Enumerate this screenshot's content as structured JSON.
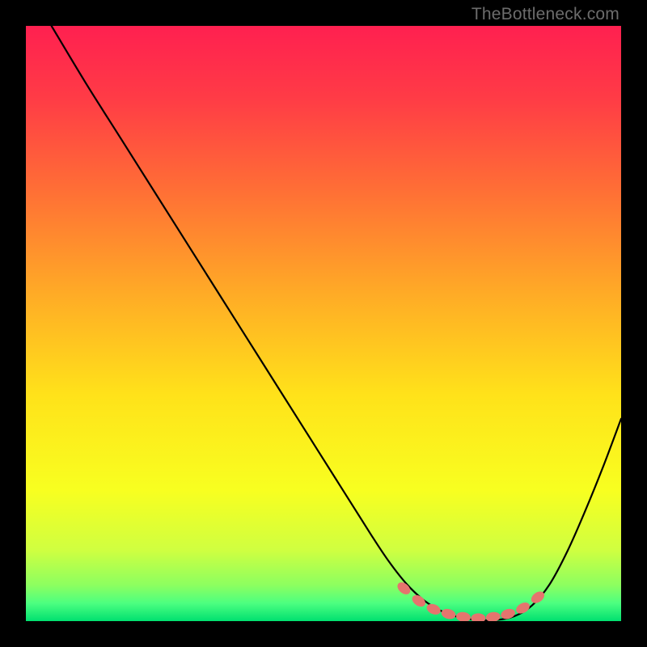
{
  "watermark": {
    "text": "TheBottleneck.com"
  },
  "chart_data": {
    "type": "line",
    "title": "",
    "xlabel": "",
    "ylabel": "",
    "xlim": [
      0,
      100
    ],
    "ylim": [
      0,
      100
    ],
    "grid": false,
    "background_gradient": {
      "stops": [
        {
          "offset": 0.0,
          "color": "#ff2050"
        },
        {
          "offset": 0.12,
          "color": "#ff3b46"
        },
        {
          "offset": 0.28,
          "color": "#ff7035"
        },
        {
          "offset": 0.45,
          "color": "#ffab26"
        },
        {
          "offset": 0.62,
          "color": "#ffe21a"
        },
        {
          "offset": 0.78,
          "color": "#f8ff20"
        },
        {
          "offset": 0.88,
          "color": "#d0ff40"
        },
        {
          "offset": 0.94,
          "color": "#8cff60"
        },
        {
          "offset": 0.97,
          "color": "#4cff80"
        },
        {
          "offset": 1.0,
          "color": "#00e070"
        }
      ]
    },
    "series": [
      {
        "name": "bottleneck-curve",
        "stroke": "#000000",
        "x": [
          4.3,
          10,
          16,
          22,
          28,
          34,
          40,
          46,
          52,
          58,
          61,
          64,
          67,
          70,
          73,
          76,
          79,
          82,
          85,
          88,
          91,
          94,
          97,
          100
        ],
        "y": [
          100,
          90.5,
          81,
          71.5,
          62,
          52.5,
          43,
          33.5,
          24,
          14.5,
          10,
          6.2,
          3.4,
          1.6,
          0.6,
          0.2,
          0.2,
          0.8,
          2.6,
          6.2,
          11.8,
          18.6,
          26,
          34
        ]
      }
    ],
    "markers": {
      "name": "optimal-zone-dots",
      "fill": "#e5746e",
      "points": [
        {
          "x": 63.5,
          "y": 5.5
        },
        {
          "x": 66.0,
          "y": 3.4
        },
        {
          "x": 68.5,
          "y": 2.0
        },
        {
          "x": 71.0,
          "y": 1.2
        },
        {
          "x": 73.5,
          "y": 0.7
        },
        {
          "x": 76.0,
          "y": 0.5
        },
        {
          "x": 78.5,
          "y": 0.7
        },
        {
          "x": 81.0,
          "y": 1.2
        },
        {
          "x": 83.5,
          "y": 2.2
        },
        {
          "x": 86.0,
          "y": 4.0
        }
      ]
    }
  }
}
